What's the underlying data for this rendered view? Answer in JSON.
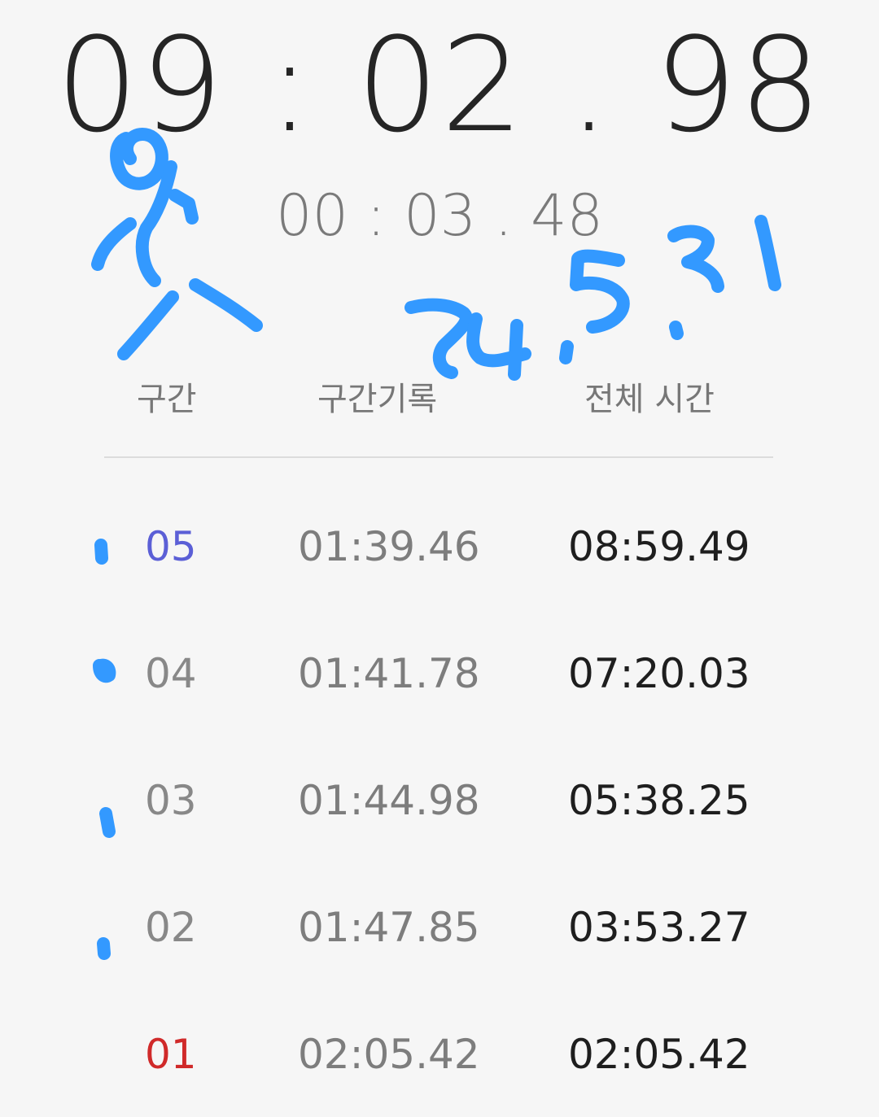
{
  "stopwatch": {
    "main_time": "09:02.98",
    "main_time_display": "09 : 02 . 98",
    "lap_time_display": "00 : 03 . 48"
  },
  "table": {
    "headers": {
      "lap": "구간",
      "split": "구간기록",
      "total": "전체 시간"
    },
    "rows": [
      {
        "num": "05",
        "split": "01:39.46",
        "total": "08:59.49",
        "status": "best"
      },
      {
        "num": "04",
        "split": "01:41.78",
        "total": "07:20.03",
        "status": "normal"
      },
      {
        "num": "03",
        "split": "01:44.98",
        "total": "05:38.25",
        "status": "normal"
      },
      {
        "num": "02",
        "split": "01:47.85",
        "total": "03:53.27",
        "status": "normal"
      },
      {
        "num": "01",
        "split": "02:05.42",
        "total": "02:05.42",
        "status": "worst"
      }
    ]
  },
  "annotation": {
    "handwritten_text": "24.5.31",
    "color": "#3399ff"
  },
  "colors": {
    "background": "#f6f6f6",
    "best_lap": "#5b5fd6",
    "worst_lap": "#d02a2a"
  }
}
